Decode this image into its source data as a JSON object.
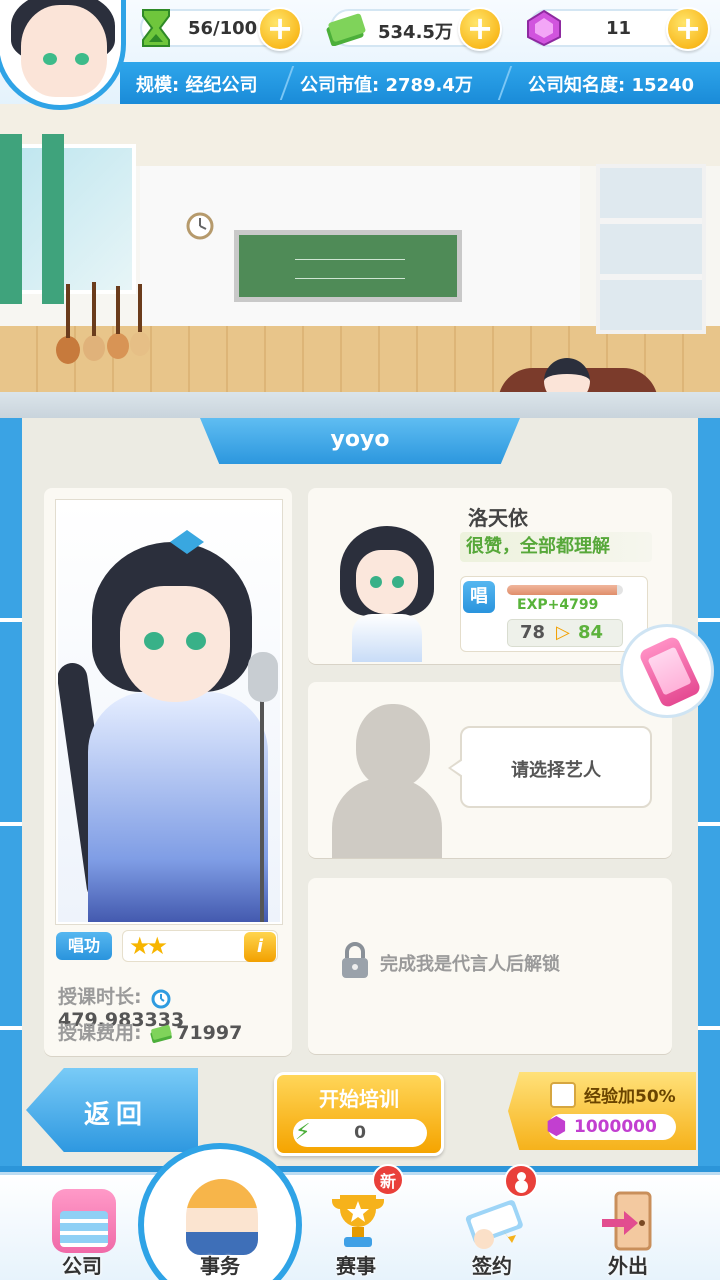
{
  "resources": {
    "energy": {
      "value": "56/100",
      "icon": "hourglass-icon"
    },
    "money": {
      "value": "534.5万",
      "icon": "cash-stack-icon"
    },
    "gems": {
      "value": "11",
      "icon": "gem-icon"
    },
    "add_label": "+"
  },
  "company": {
    "scale": "规模: 经纪公司",
    "market_value": "公司市值: 2789.4万",
    "fame": "公司知名度: 15240"
  },
  "training": {
    "artist_tab": "yoyo",
    "portrait": {
      "skill_label": "唱功",
      "stars": "★★",
      "info_label": "i",
      "lesson_time_label": "授课时长:",
      "lesson_time_value": "479.983333",
      "lesson_fee_label": "授课费用:",
      "lesson_fee_value": "71997"
    },
    "trainer": {
      "name": "洛天依",
      "comment": "很赞，全部都理解",
      "skill_tag": "唱",
      "exp_text": "EXP+4799",
      "exp_progress": 0.95,
      "level_from": "78",
      "level_to": "84"
    },
    "artist_select": {
      "prompt": "请选择艺人"
    },
    "locked_slot": {
      "text": "完成我是代言人后解锁"
    }
  },
  "actions": {
    "back_label": "返回",
    "start_label": "开始培训",
    "start_cost": "0",
    "bonus_label": "经验加50%",
    "bonus_cost": "1000000"
  },
  "nav": {
    "items": [
      {
        "label": "公司",
        "icon": "company-building-icon"
      },
      {
        "label": "事务",
        "icon": "manager-icon"
      },
      {
        "label": "赛事",
        "icon": "trophy-icon",
        "badge": "新"
      },
      {
        "label": "签约",
        "icon": "contract-scroll-icon"
      },
      {
        "label": "外出",
        "icon": "exit-door-icon"
      }
    ]
  },
  "colors": {
    "accent": "#2fa3e6",
    "gold": "#f5a400",
    "gem": "#c23fd0"
  }
}
